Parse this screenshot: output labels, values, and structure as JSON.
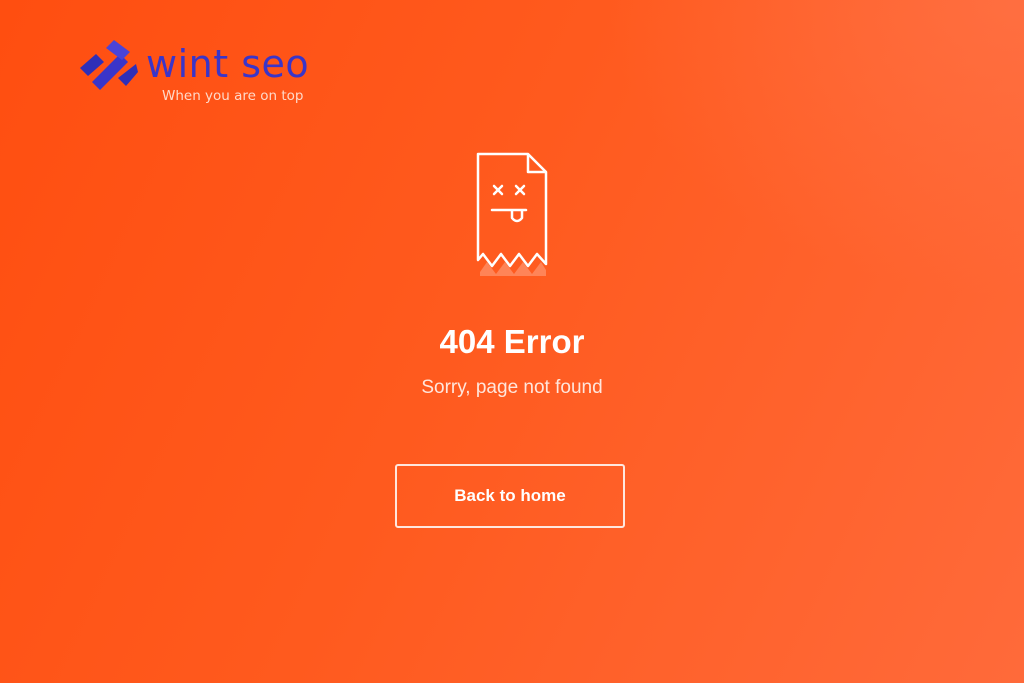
{
  "logo": {
    "name": "wint seo",
    "tagline": "When you are on top",
    "icon": "wint-seo-logo-mark",
    "name_color": "#3a35c9"
  },
  "error": {
    "icon": "broken-page-icon",
    "title": "404 Error",
    "subtitle": "Sorry, page not found"
  },
  "actions": {
    "back_label": "Back to home"
  },
  "colors": {
    "background_start": "#ff4e10",
    "background_end": "#ff6a3a",
    "text": "#ffffff"
  }
}
